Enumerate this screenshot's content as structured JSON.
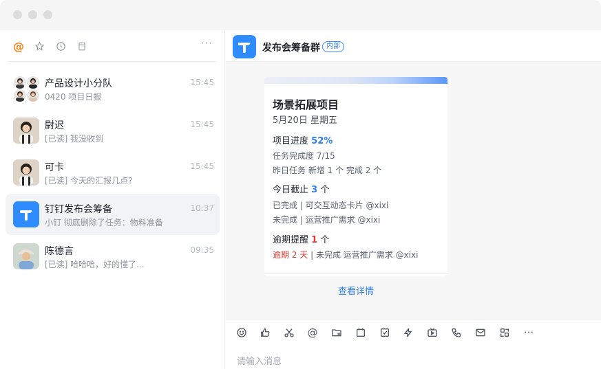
{
  "window": {
    "controls": [
      "close",
      "minimize",
      "maximize"
    ]
  },
  "left": {
    "toolbar": {
      "icons": [
        "at-icon",
        "star-icon",
        "clock-icon",
        "document-icon"
      ],
      "at_symbol": "@",
      "more": "···"
    },
    "conversations": [
      {
        "title": "产品设计小分队",
        "subtitle": "0420 项目日报",
        "time": "15:45",
        "avatar": "group-avatar"
      },
      {
        "title": "尉迟",
        "subtitle": "[已读] 我没收到",
        "time": "15:45",
        "avatar": "person-avatar"
      },
      {
        "title": "可卡",
        "subtitle": "[已读] 今天的汇报几点?",
        "time": "15:45",
        "avatar": "person-avatar"
      },
      {
        "title": "钉钉发布会筹备",
        "subtitle": "小钉 彻底删除了任务：物料准备",
        "time": "10:37",
        "avatar": "dingtalk-logo",
        "selected": true
      },
      {
        "title": "陈德言",
        "subtitle": "[已读] 哈哈哈，好的懂了...",
        "time": "09:35",
        "avatar": "person-avatar"
      }
    ]
  },
  "chat": {
    "header": {
      "title": "发布会筹备群",
      "badge": "内部"
    },
    "card": {
      "title": "场景拓展项目",
      "date": "5月20日 星期五",
      "progress": {
        "label": "项目进度",
        "value": "52%",
        "completion": "任务完成度 7/15",
        "yesterday": "昨日任务 新增 1 个 完成 2 个"
      },
      "deadline": {
        "label": "今日截止",
        "count": "3",
        "unit": "个",
        "done": "已完成 | 可交互动态卡片 @xixi",
        "undone": "未完成 | 运营推广需求 @xixi"
      },
      "overdue": {
        "label": "逾期提醒",
        "count": "1",
        "unit": "个",
        "overdue_text": "逾期 2 天",
        "rest": " | 未完成 运营推广需求 @xixi"
      },
      "link": "查看详情"
    },
    "compose": {
      "tools": [
        "emoji-icon",
        "thumbs-up-icon",
        "scissors-icon",
        "mention-icon",
        "folder-add-icon",
        "calendar-icon",
        "checkbox-icon",
        "lightning-icon",
        "live-icon",
        "phone-icon",
        "mail-icon",
        "layout-icon",
        "more-icon"
      ],
      "at_symbol": "@",
      "more": "···",
      "placeholder": "请输入消息"
    }
  },
  "colors": {
    "accent": "#2f7ff6",
    "warning": "#e8382e",
    "at_active": "#f08019",
    "brand": "#2f8cff"
  }
}
